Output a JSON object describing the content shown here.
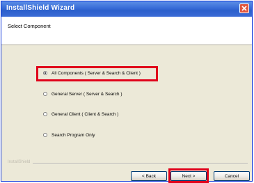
{
  "window": {
    "title": "InstallShield Wizard"
  },
  "header": {
    "title": "Select Component"
  },
  "options": [
    {
      "label": "All Components ( Server & Search & Client )",
      "selected": true
    },
    {
      "label": "General Server ( Server & Search )",
      "selected": false
    },
    {
      "label": "General Client ( Client & Search )",
      "selected": false
    },
    {
      "label": "Search Program Only",
      "selected": false
    }
  ],
  "footer": {
    "brand": "InstallShield",
    "back_label": "< Back",
    "next_label": "Next >",
    "cancel_label": "Cancel"
  },
  "colors": {
    "titlebar": "#3b6fd9",
    "highlight": "#e0001a",
    "dialog_bg": "#ece9d8"
  },
  "icons": {
    "close": "close-icon",
    "radio": "radio-button"
  }
}
